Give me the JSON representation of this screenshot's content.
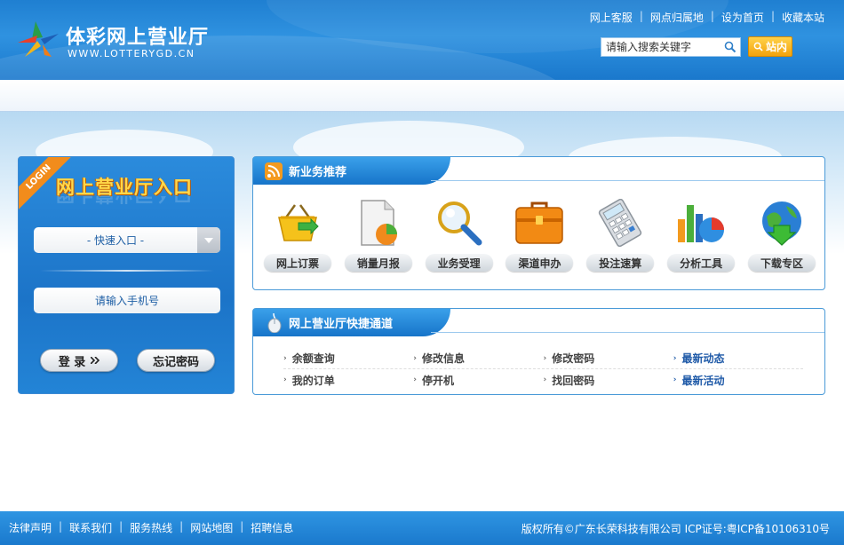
{
  "brand": {
    "title": "体彩网上营业厅",
    "subtitle": "WWW.LOTTERYGD.CN"
  },
  "top_links": [
    "网上客服",
    "网点归属地",
    "设为首页",
    "收藏本站"
  ],
  "search": {
    "placeholder": "请输入搜索关键字",
    "button_label": "站内"
  },
  "login": {
    "ribbon": "LOGIN",
    "title": "网上营业厅入口",
    "quick_entry": "- 快速入口 -",
    "phone_placeholder": "请输入手机号",
    "login_button": "登 录",
    "forgot_button": "忘记密码"
  },
  "new_business": {
    "title": "新业务推荐",
    "items": [
      {
        "label": "网上订票",
        "icon": "basket-icon"
      },
      {
        "label": "销量月报",
        "icon": "report-icon"
      },
      {
        "label": "业务受理",
        "icon": "magnifier-icon"
      },
      {
        "label": "渠道申办",
        "icon": "briefcase-icon"
      },
      {
        "label": "投注速算",
        "icon": "calculator-icon"
      },
      {
        "label": "分析工具",
        "icon": "chart-icon"
      },
      {
        "label": "下载专区",
        "icon": "download-globe-icon"
      }
    ]
  },
  "quick_channel": {
    "title": "网上营业厅快捷通道",
    "rows": [
      [
        "余额查询",
        "修改信息",
        "修改密码",
        "最新动态"
      ],
      [
        "我的订单",
        "停开机",
        "找回密码",
        "最新活动"
      ]
    ]
  },
  "footer": {
    "links": [
      "法律声明",
      "联系我们",
      "服务热线",
      "网站地图",
      "招聘信息"
    ],
    "copyright": "版权所有©广东长荣科技有限公司 ICP证号:粤ICP备10106310号"
  },
  "colors": {
    "header_blue": "#1f7fd1",
    "accent_orange": "#f28c1c",
    "title_yellow": "#ffd84a",
    "link_blue": "#1f5aa8"
  }
}
